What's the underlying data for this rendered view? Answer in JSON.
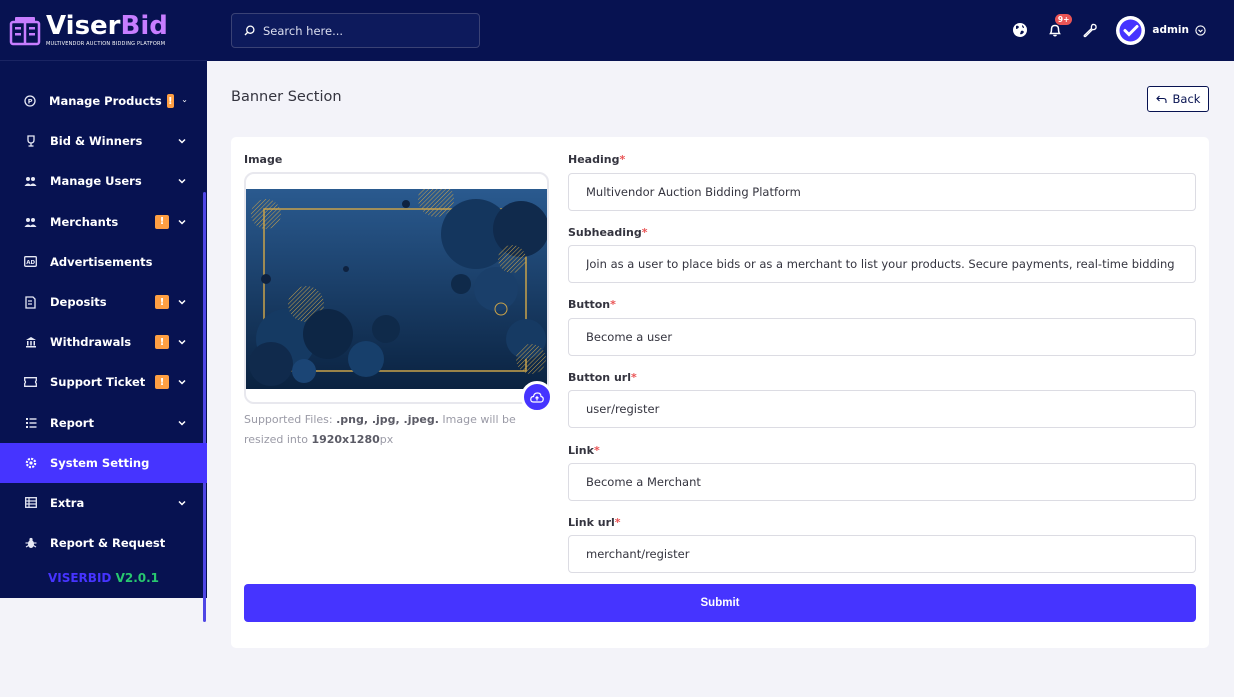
{
  "brand": {
    "title_part1": "Viser",
    "title_part2": "Bid",
    "subtitle": "MULTIVENDOR AUCTION BIDDING PLATFORM"
  },
  "search": {
    "placeholder": "Search here..."
  },
  "topbar": {
    "notification_count": "9+",
    "admin_name": "admin"
  },
  "sidebar": {
    "items": [
      {
        "label": "Manage Products",
        "warning": "!"
      },
      {
        "label": "Bid & Winners"
      },
      {
        "label": "Manage Users"
      },
      {
        "label": "Merchants",
        "warning": "!"
      },
      {
        "label": "Advertisements"
      },
      {
        "label": "Deposits",
        "warning": "!"
      },
      {
        "label": "Withdrawals",
        "warning": "!"
      },
      {
        "label": "Support Ticket",
        "warning": "!"
      },
      {
        "label": "Report"
      },
      {
        "label": "System Setting"
      },
      {
        "label": "Extra"
      },
      {
        "label": "Report & Request"
      }
    ],
    "version_name": "VISERBID",
    "version_number": "V2.0.1"
  },
  "page": {
    "title": "Banner Section",
    "back_label": "Back"
  },
  "form": {
    "image_label": "Image",
    "hint_prefix": "Supported Files: ",
    "hint_files": ".png, .jpg, .jpeg.",
    "hint_middle": " Image will be resized into ",
    "hint_size": "1920x1280",
    "hint_suffix": "px",
    "heading": {
      "label": "Heading",
      "value": "Multivendor Auction Bidding Platform"
    },
    "subheading": {
      "label": "Subheading",
      "value": "Join as a user to place bids or as a merchant to list your products. Secure payments, real-time bidding"
    },
    "button": {
      "label": "Button",
      "value": "Become a user"
    },
    "button_url": {
      "label": "Button url",
      "value": "user/register"
    },
    "link": {
      "label": "Link",
      "value": "Become a Merchant"
    },
    "link_url": {
      "label": "Link url",
      "value": "merchant/register"
    },
    "required_mark": "*",
    "submit_label": "Submit"
  },
  "colors": {
    "sidebar_bg": "#071251",
    "accent": "#4634ff",
    "warning": "#ff9f43",
    "danger": "#ea5455",
    "success": "#28c76f"
  },
  "icons": {
    "search": "search-icon",
    "globe": "globe-icon",
    "bell": "bell-icon",
    "wrench": "wrench-icon",
    "upload": "cloud-upload-icon",
    "back": "back-arrow-icon"
  }
}
